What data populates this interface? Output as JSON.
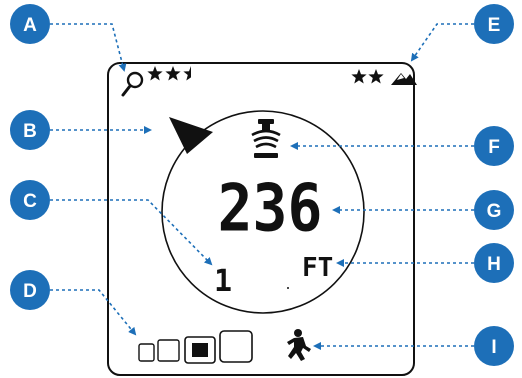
{
  "callouts": [
    "A",
    "B",
    "C",
    "D",
    "E",
    "F",
    "G",
    "H",
    "I"
  ],
  "display": {
    "reading_value": "236",
    "reading_unit": "FT",
    "secondary_digit": "1",
    "search_rating_stars": 2.5,
    "terrain_rating_stars": 2
  },
  "icons": {
    "search": "magnifier-icon",
    "terrain": "mountain-icon",
    "direction": "direction-arrow-icon",
    "beacon": "beacon-icon",
    "signal_strength": "signal-strength-boxes-icon",
    "walker": "walking-person-icon"
  },
  "colors": {
    "callout_fill": "#1d6fb8",
    "leader_line": "#1d6fb8",
    "lcd_ink": "#111111"
  }
}
